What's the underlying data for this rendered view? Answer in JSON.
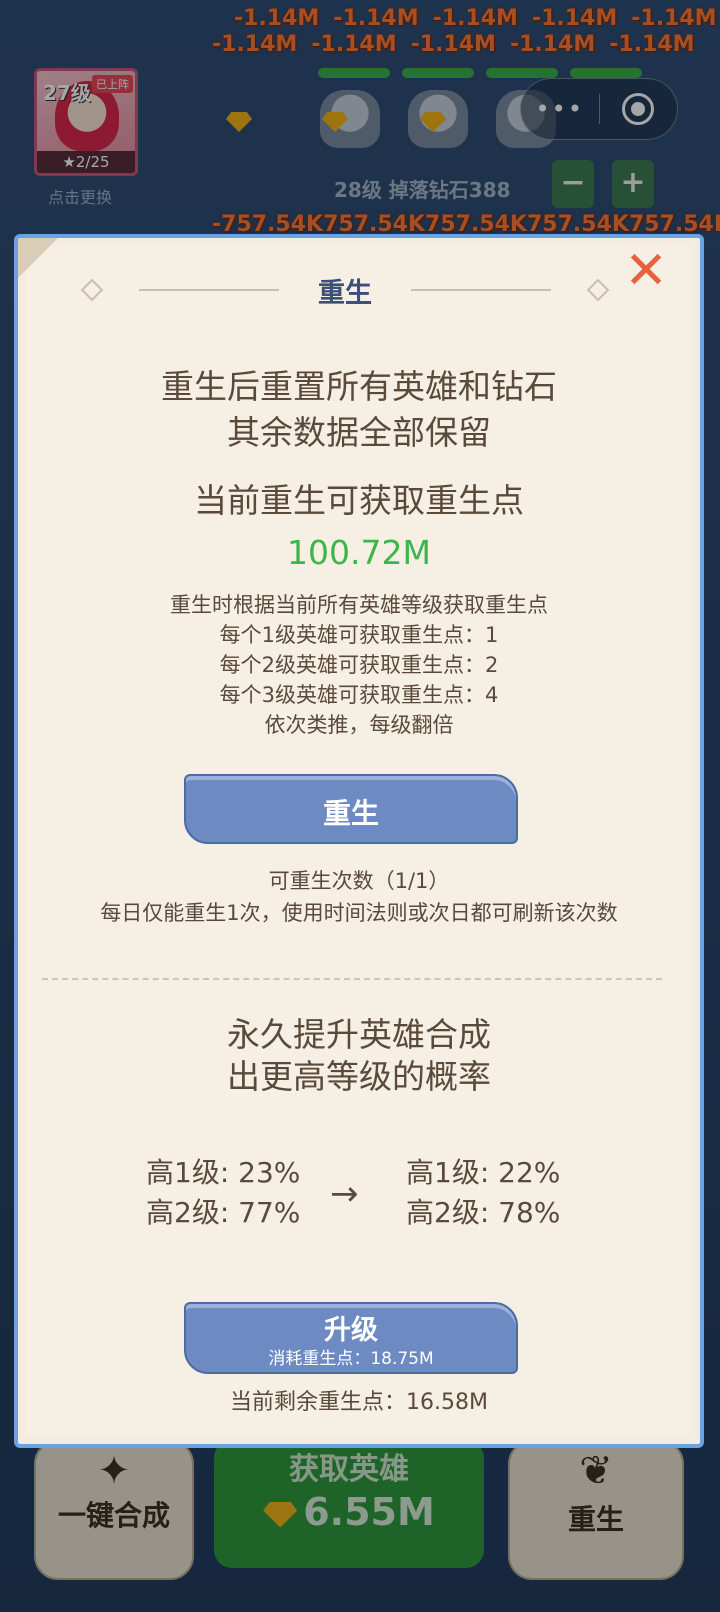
{
  "game": {
    "damage_row_1": [
      "-1.14M",
      "-1.14M",
      "-1.14M",
      "-1.14M",
      "-1.14M"
    ],
    "damage_row_2": [
      "-1.14M",
      "-1.14M",
      "-1.14M",
      "-1.14M",
      "-1.14M"
    ],
    "damage_row_3": [
      "-757.54K",
      "757.54K",
      "757.54K",
      "757.54K",
      "757.54K"
    ],
    "hero_level": "27级",
    "hero_tag": "已上阵",
    "hero_stars": "★2/25",
    "hero_switch": "点击更换",
    "drop_info": "28级 掉落钻石388",
    "minus_label": "−",
    "plus_label": "+"
  },
  "capsule": {
    "menu_icon": "more-dots-icon",
    "close_icon": "target-circle-icon"
  },
  "bottom_bar": {
    "merge_label": "一键合成",
    "get_hero_label": "获取英雄",
    "get_hero_cost": "6.55M",
    "rebirth_label": "重生"
  },
  "modal": {
    "title": "重生",
    "close_label": "✕",
    "intro_line1": "重生后重置所有英雄和钻石",
    "intro_line2": "其余数据全部保留",
    "current_points_label": "当前重生可获取重生点",
    "current_points_value": "100.72M",
    "rule_line1": "重生时根据当前所有英雄等级获取重生点",
    "rule_line2": "每个1级英雄可获取重生点：1",
    "rule_line3": "每个2级英雄可获取重生点：2",
    "rule_line4": "每个3级英雄可获取重生点：4",
    "rule_line5": "依次类推，每级翻倍",
    "rebirth_button": "重生",
    "rebirth_count": "可重生次数（1/1）",
    "rebirth_note": "每日仅能重生1次，使用时间法则或次日都可刷新该次数",
    "upgrade_title1": "永久提升英雄合成",
    "upgrade_title2": "出更高等级的概率",
    "before_high1": "高1级: 23%",
    "before_high2": "高2级: 77%",
    "arrow": "→",
    "after_high1": "高1级: 22%",
    "after_high2": "高2级: 78%",
    "upgrade_button": "升级",
    "upgrade_cost": "消耗重生点：18.75M",
    "remaining_points": "当前剩余重生点：16.58M"
  },
  "colors": {
    "accent_blue": "#6d8ac3",
    "green": "#3cb54a",
    "close_red": "#e8613f",
    "damage_orange": "#ff7a3a"
  }
}
